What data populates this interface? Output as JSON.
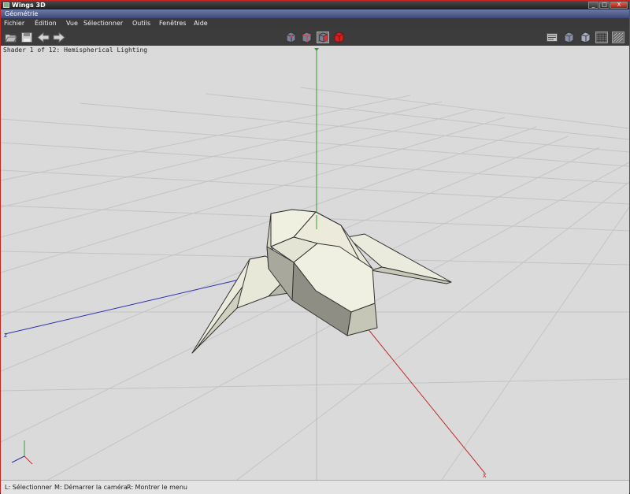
{
  "window": {
    "title": "Wings 3D",
    "buttons": [
      "_",
      "□",
      "X"
    ]
  },
  "geometry_bar": {
    "label": "Géométrie"
  },
  "menu": {
    "items": [
      "Fichier",
      "Édition",
      "Vue",
      "Sélectionner",
      "Outils",
      "Fenêtres",
      "Aide"
    ]
  },
  "toolbar": {
    "left_icons": [
      "open-folder-icon",
      "save-icon",
      "undo-arrow-icon",
      "redo-arrow-icon"
    ],
    "select_modes": [
      "vertex-mode-icon",
      "edge-mode-icon",
      "face-mode-icon",
      "body-mode-icon"
    ],
    "right_icons": [
      "info-panel-icon",
      "smooth-shading-icon",
      "flat-shading-icon",
      "wireframe-icon",
      "grid-toggle-icon"
    ]
  },
  "viewport": {
    "shader_info": "Shader 1 of 12: Hemispherical Lighting",
    "axes": {
      "x_label": "x",
      "z_label": "z",
      "x_color": "#c02020",
      "y_color": "#20a020",
      "z_color": "#2020c0"
    }
  },
  "status": {
    "left": "L: Sélectionner",
    "middle": "M: Démarrer la caméra",
    "right": "R: Montrer le menu"
  }
}
